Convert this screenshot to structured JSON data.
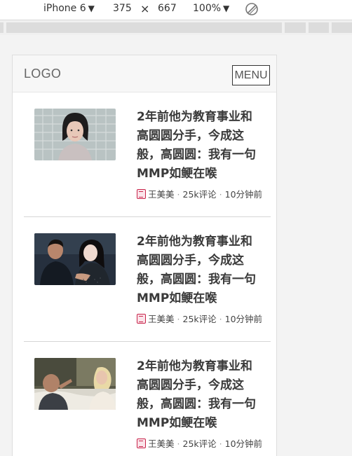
{
  "devtools": {
    "device": "iPhone 6",
    "width": "375",
    "times": "×",
    "height": "667",
    "zoom": "100%",
    "dropdown_glyph": "▼"
  },
  "header": {
    "logo": "LOGO",
    "menu_label": "MENU"
  },
  "articles": [
    {
      "title": "2年前他为教育事业和高圆圆分手，今成这般，高圆圆：我有一句MMP如鲠在喉",
      "author": "王美美",
      "comments": "25k评论",
      "time": "10分钟前",
      "sep": "·"
    },
    {
      "title": "2年前他为教育事业和高圆圆分手，今成这般，高圆圆：我有一句MMP如鲠在喉",
      "author": "王美美",
      "comments": "25k评论",
      "time": "10分钟前",
      "sep": "·"
    },
    {
      "title": "2年前他为教育事业和高圆圆分手，今成这般，高圆圆：我有一句MMP如鲠在喉",
      "author": "王美美",
      "comments": "25k评论",
      "time": "10分钟前",
      "sep": "·"
    }
  ]
}
